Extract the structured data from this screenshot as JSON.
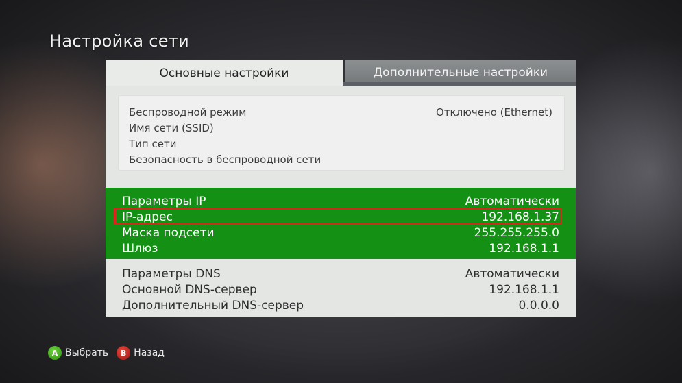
{
  "page": {
    "title": "Настройка сети"
  },
  "tabs": [
    {
      "label": "Основные настройки",
      "active": true
    },
    {
      "label": "Дополнительные настройки",
      "active": false
    }
  ],
  "wireless": {
    "rows": [
      {
        "label": "Беспроводной режим",
        "value": "Отключено (Ethernet)"
      },
      {
        "label": "Имя сети (SSID)",
        "value": ""
      },
      {
        "label": "Тип сети",
        "value": ""
      },
      {
        "label": "Безопасность в беспроводной сети",
        "value": ""
      }
    ]
  },
  "ip_settings": {
    "rows": [
      {
        "label": "Параметры IP",
        "value": "Автоматически"
      },
      {
        "label": "IP-адрес",
        "value": "192.168.1.37"
      },
      {
        "label": "Маска подсети",
        "value": "255.255.255.0"
      },
      {
        "label": "Шлюз",
        "value": "192.168.1.1"
      }
    ]
  },
  "dns_settings": {
    "rows": [
      {
        "label": "Параметры DNS",
        "value": "Автоматически"
      },
      {
        "label": "Основной DNS-сервер",
        "value": "192.168.1.1"
      },
      {
        "label": "Дополнительный DNS-сервер",
        "value": "0.0.0.0"
      }
    ]
  },
  "footer": {
    "a": {
      "glyph": "A",
      "label": "Выбрать",
      "icon": "a-button-icon"
    },
    "b": {
      "glyph": "B",
      "label": "Назад",
      "icon": "b-button-icon"
    }
  },
  "colors": {
    "selected_green": "#149114",
    "highlight_red": "#d8261e",
    "button_a_green": "#4bb025",
    "button_b_red": "#c52a22"
  }
}
